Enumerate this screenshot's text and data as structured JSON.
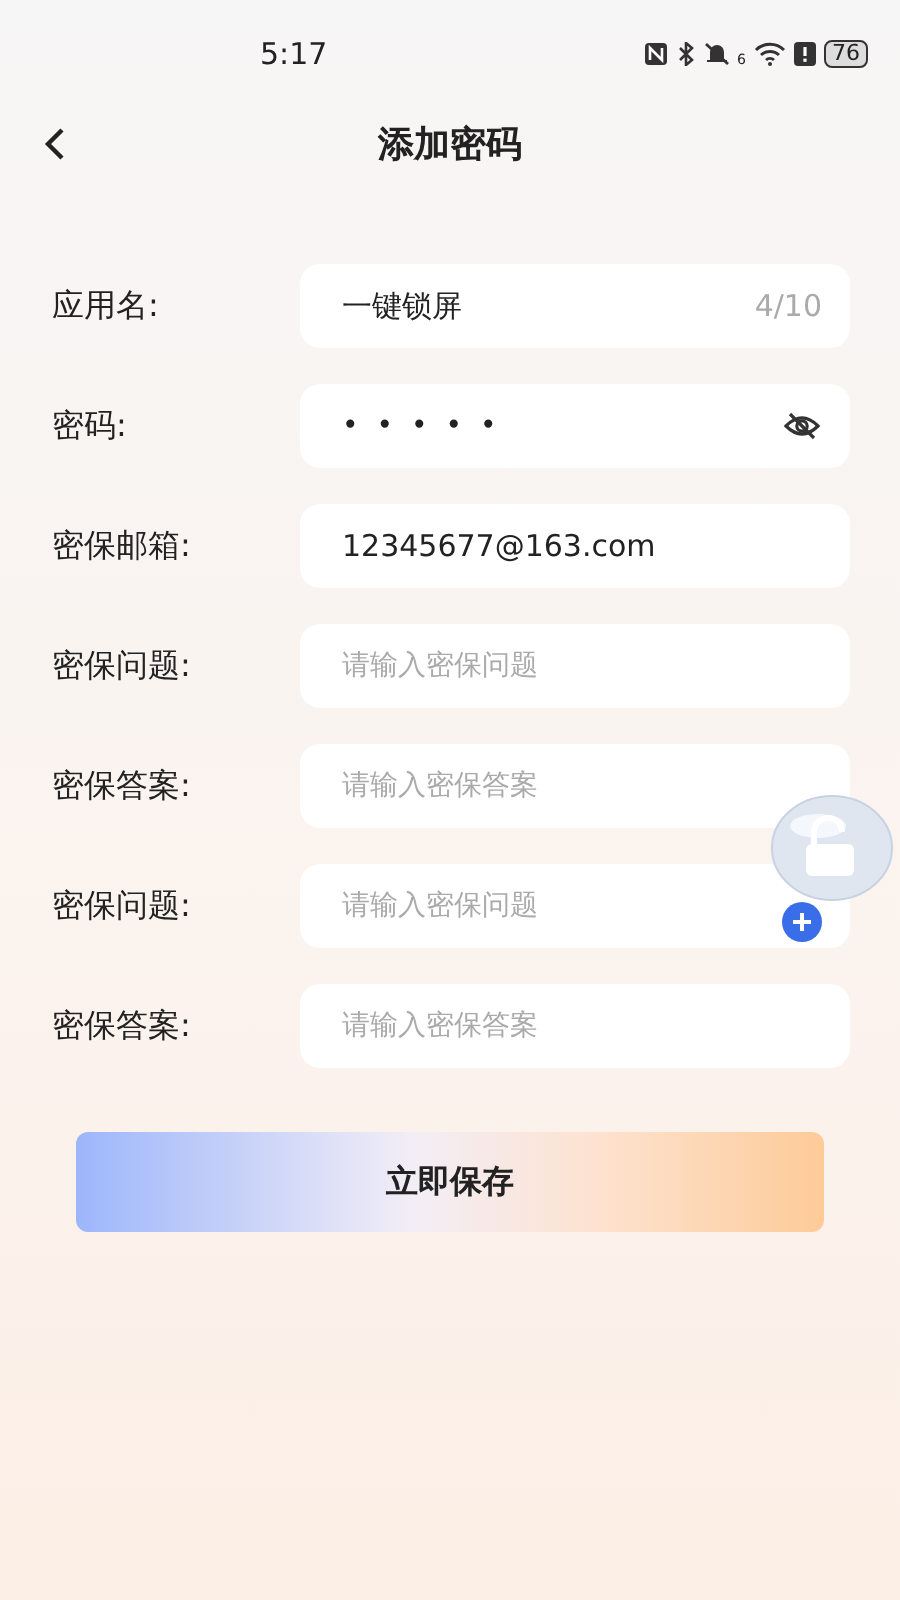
{
  "status_bar": {
    "time": "5:17",
    "wifi_badge": "6",
    "battery": "76"
  },
  "header": {
    "title": "添加密码"
  },
  "fields": [
    {
      "kind": "counter",
      "label": "应用名:",
      "value": "一键锁屏",
      "counter": "4/10"
    },
    {
      "kind": "password",
      "label": "密码:",
      "value": "•••••"
    },
    {
      "kind": "text",
      "label": "密保邮箱:",
      "value": "12345677@163.com"
    },
    {
      "kind": "text",
      "label": "密保问题:",
      "placeholder": "请输入密保问题"
    },
    {
      "kind": "text",
      "label": "密保答案:",
      "placeholder": "请输入密保答案"
    },
    {
      "kind": "add",
      "label": "密保问题:",
      "placeholder": "请输入密保问题"
    },
    {
      "kind": "text",
      "label": "密保答案:",
      "placeholder": "请输入密保答案"
    }
  ],
  "save_button": "立即保存"
}
